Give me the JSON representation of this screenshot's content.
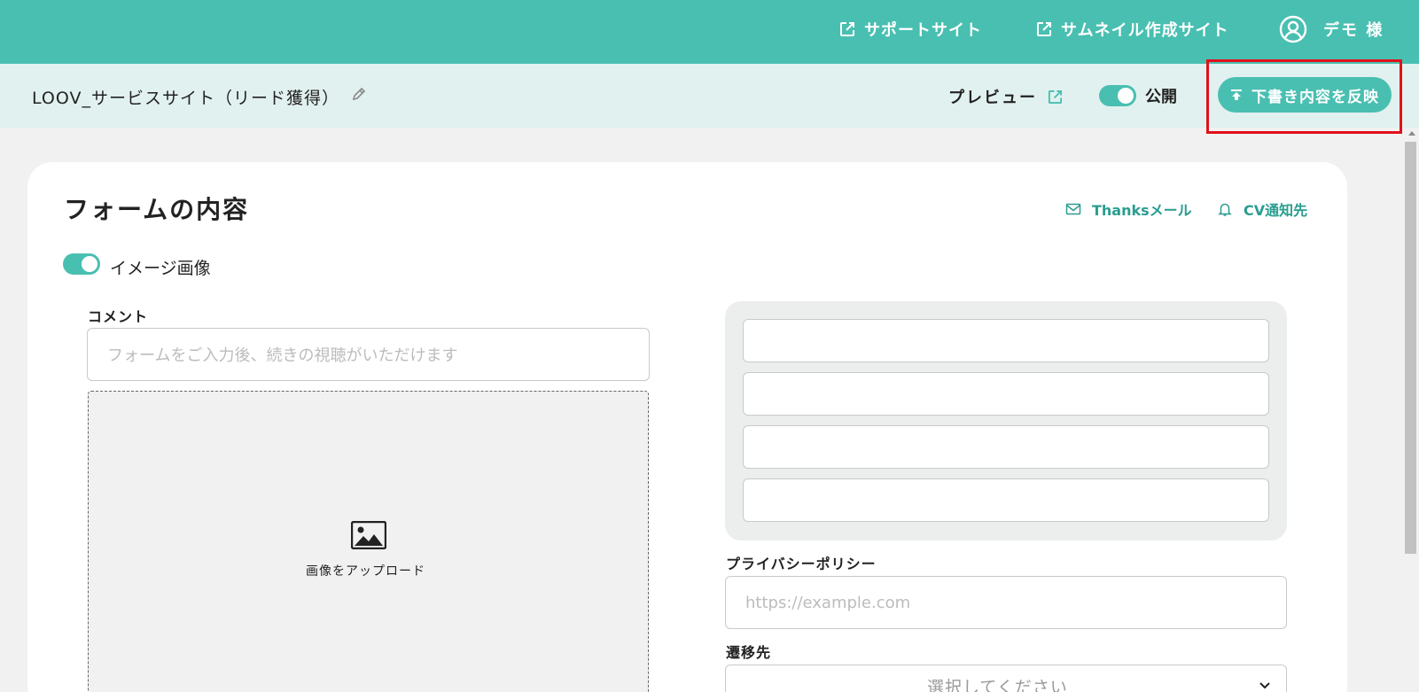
{
  "topbar": {
    "support_link": "サポートサイト",
    "thumbnail_link": "サムネイル作成サイト",
    "user_label": "デモ 様"
  },
  "subbar": {
    "title": "LOOV_サービスサイト（リード獲得）",
    "preview_label": "プレビュー",
    "publish_label": "公開",
    "publish_on": true,
    "apply_button_label": "下書き内容を反映"
  },
  "form_card": {
    "title": "フォームの内容",
    "thanks_mail_link": "Thanksメール",
    "cv_notify_link": "CV通知先",
    "image_toggle_label": "イメージ画像",
    "image_toggle_on": true,
    "comment_label": "コメント",
    "comment_placeholder": "フォームをご入力後、続きの視聴がいただけます",
    "upload_label": "画像をアップロード",
    "privacy_label": "プライバシーポリシー",
    "privacy_placeholder": "https://example.com",
    "destination_label": "遷移先",
    "destination_select": "選択してください"
  },
  "colors": {
    "accent": "#49bfb1",
    "accent_text": "#2a9d90",
    "highlight": "#e0101a"
  },
  "icons": [
    "external-link-icon",
    "user-avatar-icon",
    "pencil-icon",
    "upload-icon",
    "mail-icon",
    "bell-icon",
    "image-icon",
    "chevron-down-icon"
  ]
}
